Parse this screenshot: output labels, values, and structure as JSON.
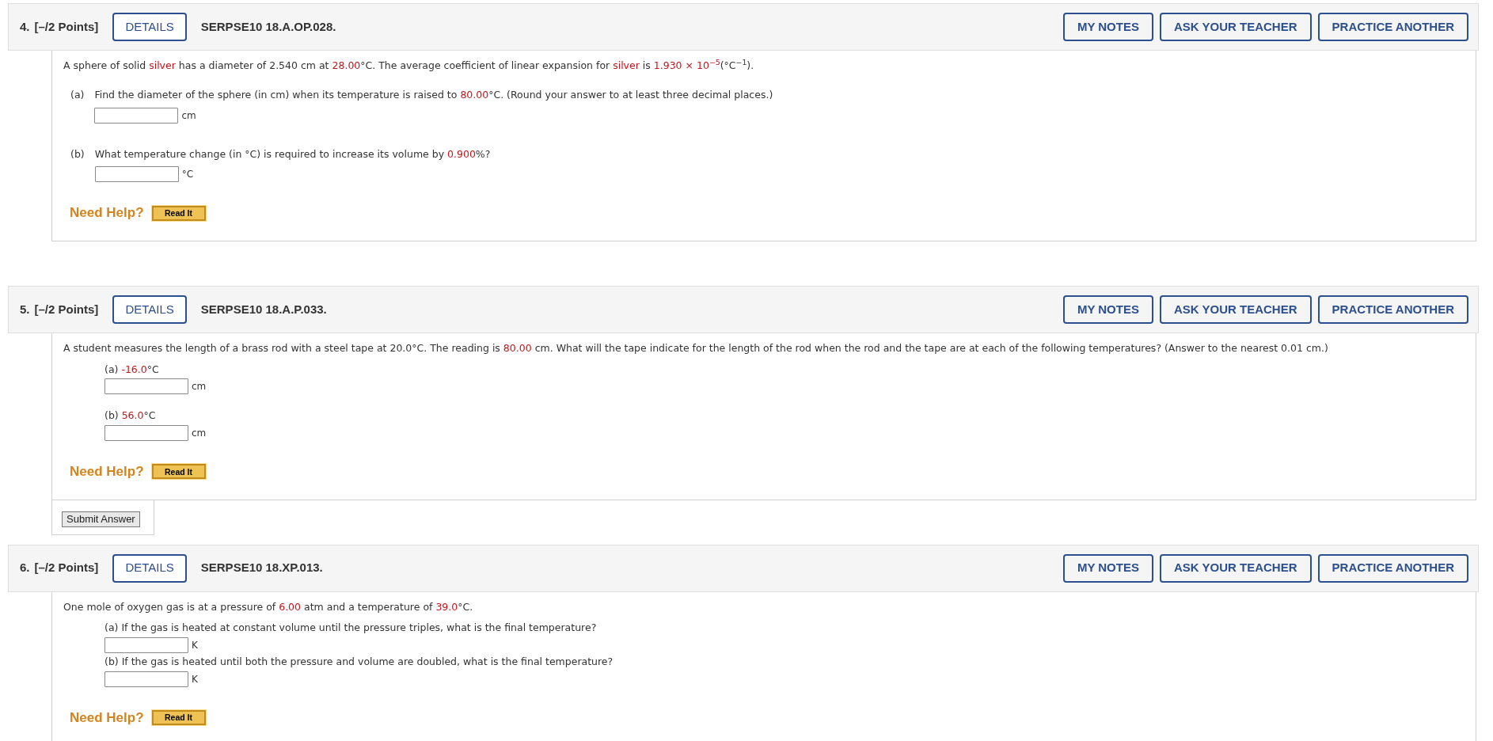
{
  "questions": [
    {
      "number": "4.",
      "points": "[–/2 Points]",
      "details": "DETAILS",
      "code": "SERPSE10 18.A.OP.028.",
      "actions": [
        "MY NOTES",
        "ASK YOUR TEACHER",
        "PRACTICE ANOTHER"
      ],
      "intro": [
        {
          "text": "A sphere of solid ",
          "highlighted": false
        },
        {
          "text": "silver",
          "highlighted": true
        },
        {
          "text": " has a diameter of 2.540 cm at ",
          "highlighted": false
        },
        {
          "text": "28.00",
          "highlighted": true
        },
        {
          "text": "°C. The average coefficient of linear expansion for ",
          "highlighted": false
        },
        {
          "text": "silver",
          "highlighted": true
        },
        {
          "text": " is ",
          "highlighted": false
        },
        {
          "text": "1.930 × 10$^{−5}$",
          "highlighted": true
        },
        {
          "text": "(°C$^{−1}$).",
          "highlighted": false
        }
      ],
      "kind": "labeled",
      "parts": [
        {
          "label": "(a)",
          "prompt": [
            {
              "text": "Find the diameter of the sphere (in cm) when its temperature is raised to ",
              "highlighted": false
            },
            {
              "text": "80.00",
              "highlighted": true
            },
            {
              "text": "°C. (Round your answer to at least three decimal places.)",
              "highlighted": false
            }
          ],
          "unit": "cm"
        },
        {
          "label": "(b)",
          "prompt": [
            {
              "text": "What temperature change (in °C) is required to increase its volume by ",
              "highlighted": false
            },
            {
              "text": "0.900",
              "highlighted": true
            },
            {
              "text": "%?",
              "highlighted": false
            }
          ],
          "unit": "°C"
        }
      ],
      "help": "Need Help?",
      "read_it": "Read It"
    },
    {
      "number": "5.",
      "points": "[–/2 Points]",
      "details": "DETAILS",
      "code": "SERPSE10 18.A.P.033.",
      "actions": [
        "MY NOTES",
        "ASK YOUR TEACHER",
        "PRACTICE ANOTHER"
      ],
      "intro": [
        {
          "text": "A student measures the length of a brass rod with a steel tape at 20.0°C. The reading is ",
          "highlighted": false
        },
        {
          "text": "80.00",
          "highlighted": true
        },
        {
          "text": " cm. What will the tape indicate for the length of the rod when the rod and the tape are at each of the following temperatures? (Answer to the nearest 0.01 cm.)",
          "highlighted": false
        }
      ],
      "kind": "spaced",
      "parts": [
        {
          "prompt": [
            {
              "text": "(a) ",
              "highlighted": false
            },
            {
              "text": "-16.0",
              "highlighted": true
            },
            {
              "text": "°C",
              "highlighted": false
            }
          ],
          "unit": "cm"
        },
        {
          "prompt": [
            {
              "text": "(b) ",
              "highlighted": false
            },
            {
              "text": "56.0",
              "highlighted": true
            },
            {
              "text": "°C",
              "highlighted": false
            }
          ],
          "unit": "cm"
        }
      ],
      "help": "Need Help?",
      "read_it": "Read It",
      "submit": "Submit Answer"
    },
    {
      "number": "6.",
      "points": "[–/2 Points]",
      "details": "DETAILS",
      "code": "SERPSE10 18.XP.013.",
      "actions": [
        "MY NOTES",
        "ASK YOUR TEACHER",
        "PRACTICE ANOTHER"
      ],
      "intro": [
        {
          "text": "One mole of oxygen gas is at a pressure of ",
          "highlighted": false
        },
        {
          "text": "6.00",
          "highlighted": true
        },
        {
          "text": " atm and a temperature of ",
          "highlighted": false
        },
        {
          "text": "39.0",
          "highlighted": true
        },
        {
          "text": "°C.",
          "highlighted": false
        }
      ],
      "kind": "compact",
      "parts": [
        {
          "prompt": [
            {
              "text": "(a) If the gas is heated at constant volume until the pressure triples, what is the final temperature?",
              "highlighted": false
            }
          ],
          "unit": "K"
        },
        {
          "prompt": [
            {
              "text": "(b) If the gas is heated until both the pressure and volume are doubled, what is the final temperature?",
              "highlighted": false
            }
          ],
          "unit": "K"
        }
      ],
      "help": "Need Help?",
      "read_it": "Read It"
    }
  ]
}
